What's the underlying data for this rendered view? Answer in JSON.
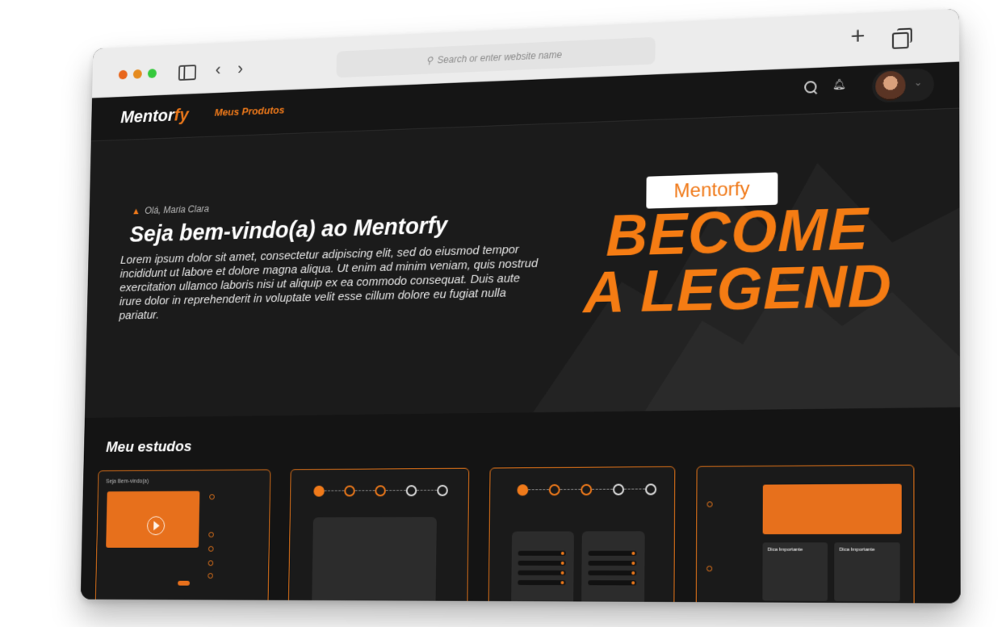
{
  "browser": {
    "url_placeholder": "Search or enter website name"
  },
  "nav": {
    "logo_main": "Mentor",
    "logo_accent": "fy",
    "link_products": "Meus Produtos"
  },
  "hero": {
    "greeting": "Olá, Maria Clara",
    "title": "Seja bem-vindo(a) ao Mentorfy",
    "text": "Lorem ipsum dolor sit amet, consectetur adipiscing elit, sed do eiusmod tempor incididunt ut labore et dolore magna aliqua. Ut enim ad minim veniam, quis nostrud exercitation ullamco laboris nisi ut aliquip ex ea commodo consequat. Duis aute irure dolor in reprehenderit in voluptate velit esse cillum dolore eu fugiat nulla pariatur.",
    "badge": "Mentorfy",
    "slogan_line1": "BECOME",
    "slogan_line2": "A LEGEND"
  },
  "studies": {
    "title": "Meu estudos",
    "card1_caption": "Seja Bem-vindo(a)",
    "card4_header": "Dica Importante"
  },
  "colors": {
    "accent": "#f07a1a",
    "background": "#141414"
  }
}
